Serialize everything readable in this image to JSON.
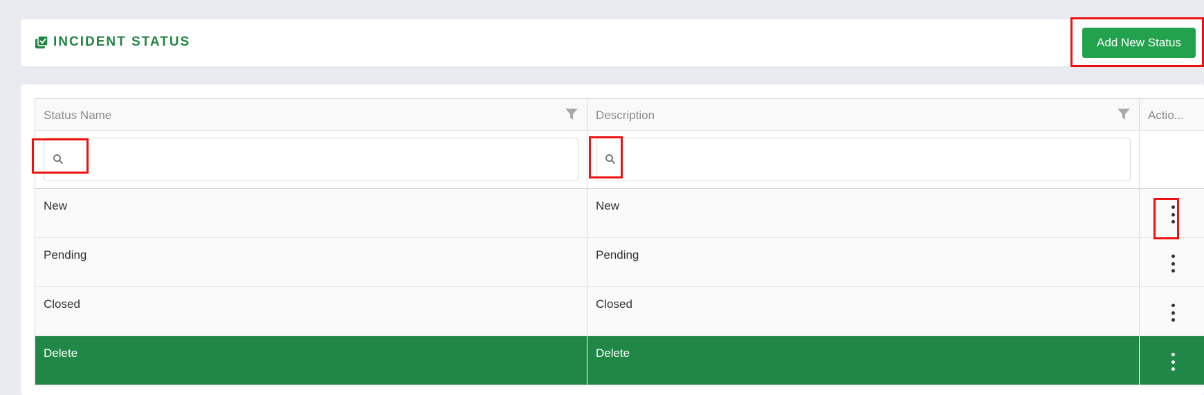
{
  "header": {
    "title": "INCIDENT STATUS",
    "title_icon": "check-square-stack-icon",
    "add_button_label": "Add New Status"
  },
  "table": {
    "columns": [
      {
        "label": "Status Name",
        "filter_icon": "filter-funnel-icon"
      },
      {
        "label": "Description",
        "filter_icon": "filter-funnel-icon"
      },
      {
        "label": "Actio..."
      }
    ],
    "filters": {
      "status_name": {
        "value": "",
        "placeholder": ""
      },
      "description": {
        "value": "",
        "placeholder": ""
      }
    },
    "rows": [
      {
        "status_name": "New",
        "description": "New",
        "selected": false
      },
      {
        "status_name": "Pending",
        "description": "Pending",
        "selected": false
      },
      {
        "status_name": "Closed",
        "description": "Closed",
        "selected": false
      },
      {
        "status_name": "Delete",
        "description": "Delete",
        "selected": true
      }
    ]
  },
  "colors": {
    "accent_green": "#218642",
    "button_green": "#23a24d",
    "selected_row": "#218747",
    "highlight_red": "#ee1111"
  }
}
